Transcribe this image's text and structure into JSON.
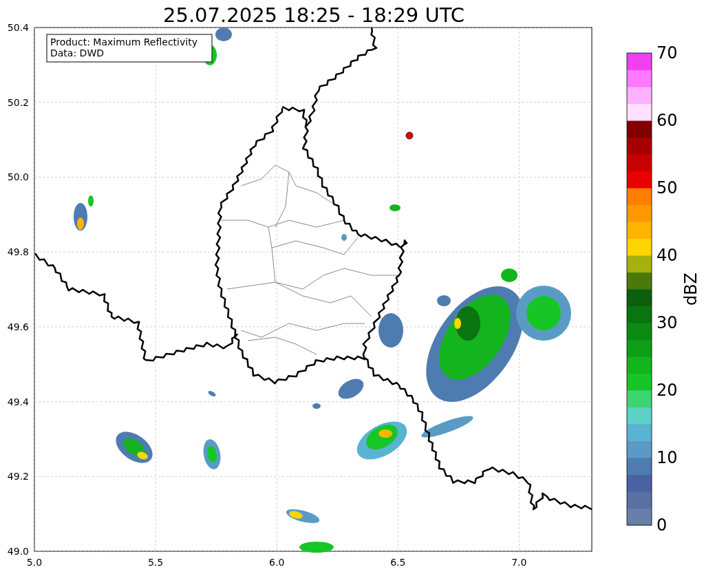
{
  "title": "25.07.2025 18:25 - 18:29 UTC",
  "info_box": {
    "lines": [
      "Product: Maximum Reflectivity",
      "Data: DWD"
    ]
  },
  "map": {
    "xticks": [
      "5.0",
      "5.5",
      "6.0",
      "6.5",
      "7.0"
    ],
    "yticks": [
      "50.4",
      "50.2",
      "50.0",
      "49.8",
      "49.6",
      "49.4",
      "49.2",
      "49.0"
    ]
  },
  "colorbar": {
    "label": "dBZ",
    "ticks": [
      "70",
      "60",
      "50",
      "40",
      "30",
      "20",
      "10",
      "0"
    ]
  }
}
